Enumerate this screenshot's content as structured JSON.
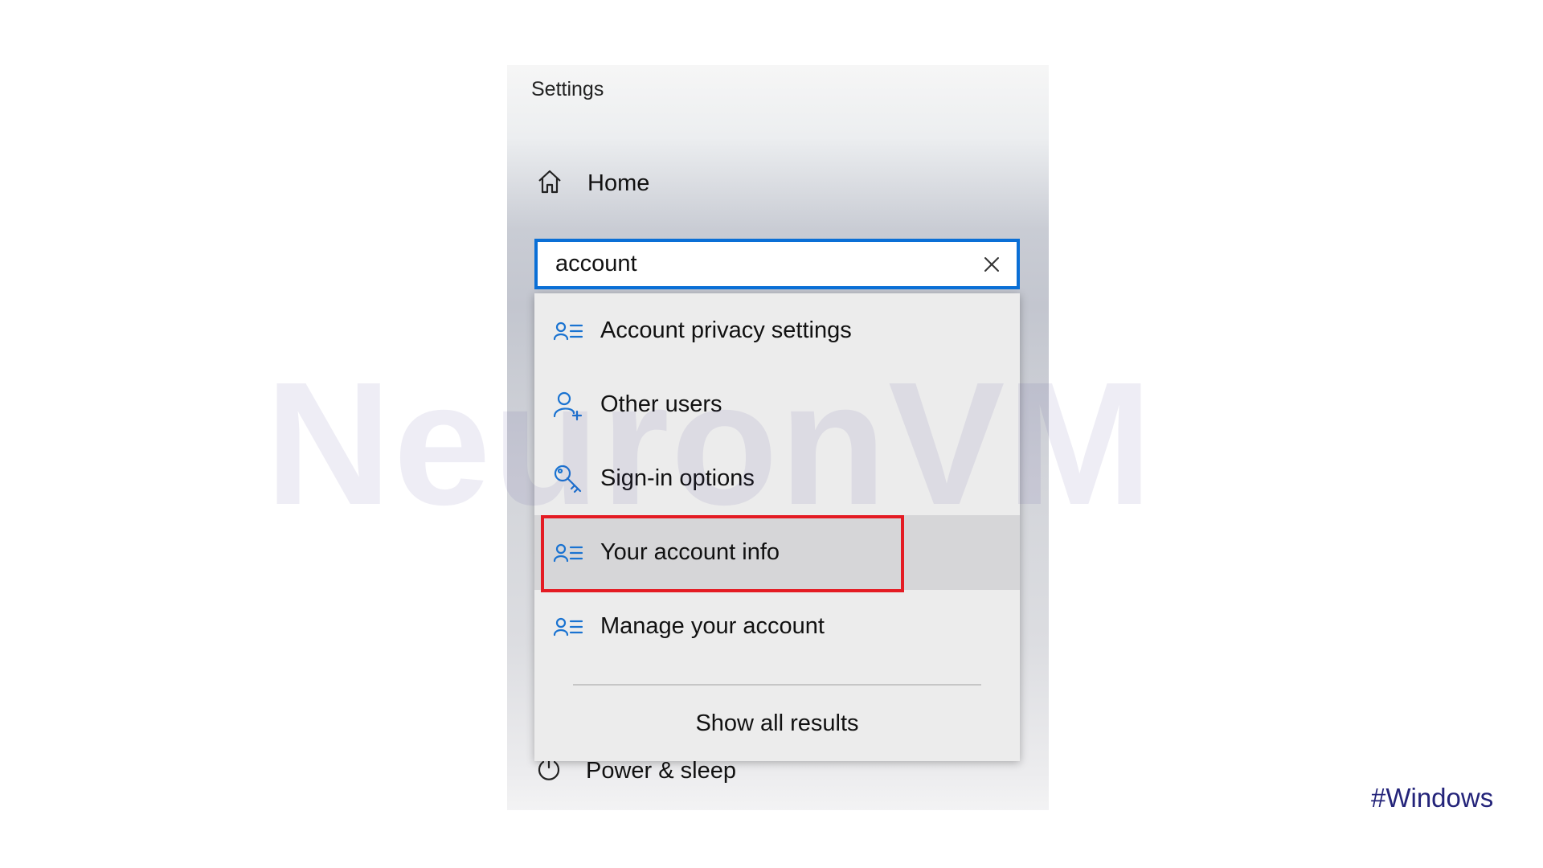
{
  "window": {
    "title": "Settings"
  },
  "nav": {
    "home_label": "Home",
    "power_label": "Power & sleep"
  },
  "search": {
    "value": "account",
    "clear_icon": "close-icon"
  },
  "results": [
    {
      "label": "Account privacy settings",
      "icon": "account-info-icon"
    },
    {
      "label": "Other users",
      "icon": "add-user-icon"
    },
    {
      "label": "Sign-in options",
      "icon": "key-icon"
    },
    {
      "label": "Your account info",
      "icon": "account-info-icon",
      "selected": true
    },
    {
      "label": "Manage your account",
      "icon": "account-info-icon"
    }
  ],
  "show_all_label": "Show all results",
  "overlay": {
    "watermark": "NeuronVM",
    "hashtag": "#Windows"
  },
  "colors": {
    "accent_blue": "#0a6fd6",
    "highlight_red": "#e41b23",
    "hashtag_navy": "#24247a"
  }
}
